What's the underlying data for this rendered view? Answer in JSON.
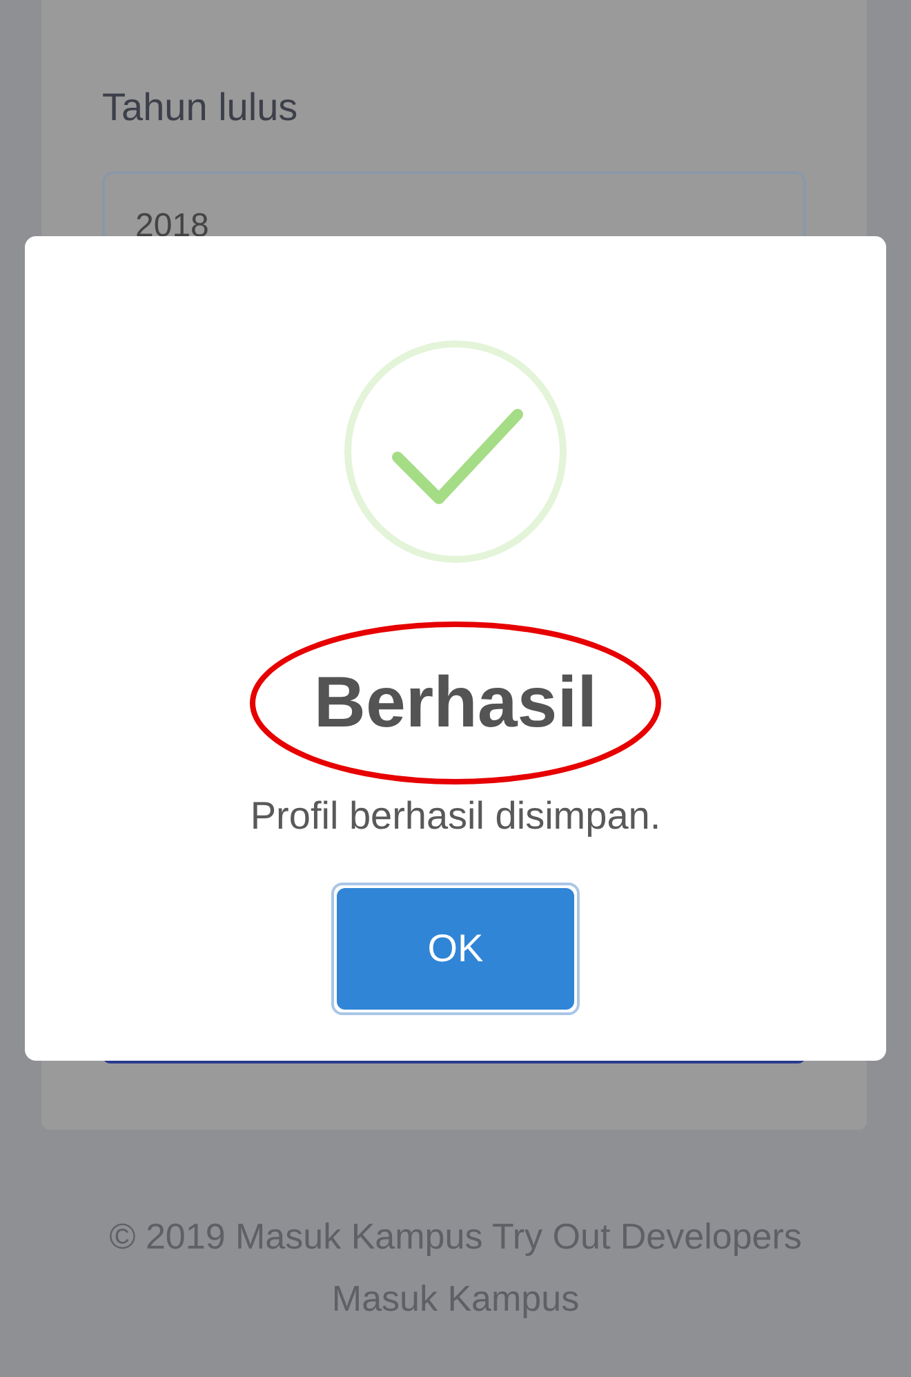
{
  "form": {
    "label": "Tahun lulus",
    "field_value": "2018"
  },
  "dialog": {
    "success": true,
    "title": "Berhasil",
    "title_highlighted": true,
    "message": "Profil berhasil disimpan.",
    "button": "OK"
  },
  "footer": {
    "copyright": "© 2019 Masuk Kampus Try Out Developers",
    "brand": "Masuk Kampus"
  }
}
